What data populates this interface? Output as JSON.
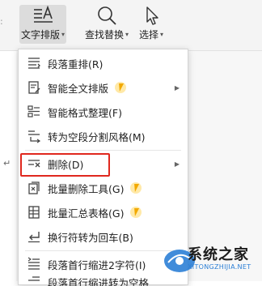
{
  "ribbon": {
    "text_layout": "文字排版",
    "find_replace": "查找替换",
    "select": "选择"
  },
  "menu": {
    "items": [
      {
        "label": "段落重排(R)",
        "icon": "paragraph-reflow-icon"
      },
      {
        "label": "智能全文排版",
        "icon": "smart-layout-icon",
        "premium": true,
        "submenu": true
      },
      {
        "label": "智能格式整理(F)",
        "icon": "format-cleanup-icon"
      },
      {
        "label": "转为空段分割风格(M)",
        "icon": "empty-paragraph-style-icon"
      },
      {
        "label": "删除(D)",
        "icon": "delete-icon",
        "submenu": true
      },
      {
        "label": "批量删除工具(G)",
        "icon": "batch-delete-icon",
        "premium": true
      },
      {
        "label": "批量汇总表格(G)",
        "icon": "batch-summary-icon",
        "premium": true
      },
      {
        "label": "换行符转为回车(B)",
        "icon": "linebreak-convert-icon"
      },
      {
        "label": "段落首行缩进2字符(I)",
        "icon": "first-line-indent-icon"
      },
      {
        "label": "段落首行缩进转为空格",
        "icon": "indent-to-space-icon"
      }
    ]
  },
  "colors": {
    "highlight": "#e0281e",
    "premium": "#f2a900",
    "watermark_accent": "#2c7fd6"
  },
  "watermark": {
    "title": "系统之家",
    "url": "XITONGZHIJIA.NET"
  }
}
